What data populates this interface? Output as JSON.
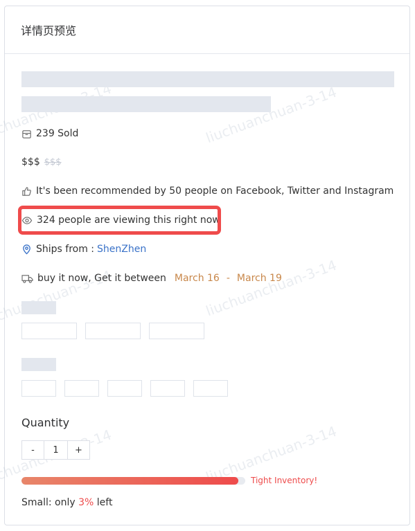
{
  "header": {
    "title": "详情页预览"
  },
  "sold": {
    "text": "239 Sold"
  },
  "price": {
    "current": "$$$",
    "original": "$$$"
  },
  "social": {
    "text": "It's been recommended by 50 people on Facebook, Twitter and Instagram"
  },
  "viewing": {
    "text": "324 people are viewing this right now"
  },
  "shipping": {
    "label": "Ships from :",
    "location": "ShenZhen"
  },
  "delivery": {
    "label": "buy it now, Get it between",
    "start": "March 16",
    "separator": "-",
    "end": "March 19"
  },
  "quantity": {
    "label": "Quantity",
    "decrement": "-",
    "value": "1",
    "increment": "+"
  },
  "inventory": {
    "fill_fraction": 0.97,
    "label": "Tight Inventory!"
  },
  "stock": {
    "prefix": "Small: only",
    "percent": "3%",
    "suffix": "left"
  },
  "watermark": {
    "text": "liuchuanchuan-3-14"
  },
  "colors": {
    "highlight": "#ef4b4b",
    "link": "#3a72c8",
    "date": "#c8874a",
    "danger": "#ee4b4b"
  }
}
